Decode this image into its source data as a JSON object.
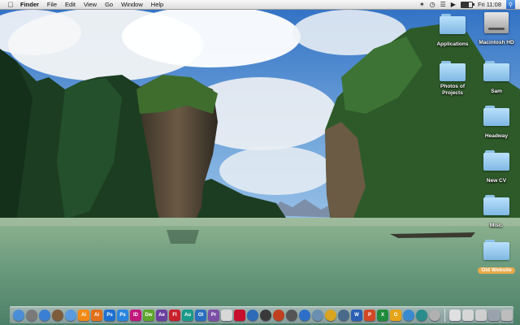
{
  "menubar": {
    "app_name": "Finder",
    "menus": [
      "File",
      "Edit",
      "View",
      "Go",
      "Window",
      "Help"
    ],
    "clock": "Fri 11:08",
    "status_icons": [
      "bluetooth-icon",
      "time-machine-icon",
      "wifi-icon",
      "volume-icon",
      "battery-icon",
      "spotlight-icon"
    ]
  },
  "desktop_icons": [
    {
      "label": "Applications",
      "type": "folder"
    },
    {
      "label": "Macintosh HD",
      "type": "drive"
    },
    {
      "label": "Photos of Projects",
      "type": "folder"
    },
    {
      "label": "Sam",
      "type": "folder"
    },
    {
      "label": "Headway",
      "type": "folder"
    },
    {
      "label": "New CV",
      "type": "folder"
    },
    {
      "label": "Misc.",
      "type": "folder"
    },
    {
      "label": "Old Website",
      "type": "folder",
      "selected": true
    }
  ],
  "dock": {
    "apps": [
      {
        "glyph": "",
        "color": "#4a8fd6"
      },
      {
        "glyph": "",
        "color": "#7a7a7a"
      },
      {
        "glyph": "",
        "color": "#3b7fd4"
      },
      {
        "glyph": "",
        "color": "#7c5c3a"
      },
      {
        "glyph": "",
        "color": "#5a9be0"
      },
      {
        "glyph": "Ai",
        "color": "#f28a14"
      },
      {
        "glyph": "Ai",
        "color": "#e2701a"
      },
      {
        "glyph": "Ps",
        "color": "#1d6fd1"
      },
      {
        "glyph": "Ps",
        "color": "#2a84e0"
      },
      {
        "glyph": "ID",
        "color": "#c2187c"
      },
      {
        "glyph": "Dw",
        "color": "#5ea52b"
      },
      {
        "glyph": "Ae",
        "color": "#6b3fa0"
      },
      {
        "glyph": "Fl",
        "color": "#c8202c"
      },
      {
        "glyph": "Au",
        "color": "#1a9a8a"
      },
      {
        "glyph": "Ol",
        "color": "#2a6fbf"
      },
      {
        "glyph": "Pr",
        "color": "#7b4fa6"
      },
      {
        "glyph": "",
        "color": "#d8d8d8"
      },
      {
        "glyph": "",
        "color": "#c8102e"
      },
      {
        "glyph": "",
        "color": "#2d6bb8"
      },
      {
        "glyph": "",
        "color": "#3a3a3a"
      },
      {
        "glyph": "",
        "color": "#c04020"
      },
      {
        "glyph": "",
        "color": "#555555"
      },
      {
        "glyph": "",
        "color": "#2d6fc8"
      },
      {
        "glyph": "",
        "color": "#6a8fb0"
      },
      {
        "glyph": "",
        "color": "#d9a520"
      },
      {
        "glyph": "",
        "color": "#4a6a8a"
      },
      {
        "glyph": "W",
        "color": "#2a5fb5"
      },
      {
        "glyph": "P",
        "color": "#d24726"
      },
      {
        "glyph": "X",
        "color": "#1f8a3b"
      },
      {
        "glyph": "O",
        "color": "#e6a417"
      },
      {
        "glyph": "",
        "color": "#3a8ad0"
      },
      {
        "glyph": "",
        "color": "#2a8c8c"
      },
      {
        "glyph": "",
        "color": "#b0b0b0"
      }
    ],
    "stack_colors": [
      "#e0e0e0",
      "#d6d6d6",
      "#cfcfcf",
      "#9aa3ad",
      "#bdbdbd"
    ]
  }
}
